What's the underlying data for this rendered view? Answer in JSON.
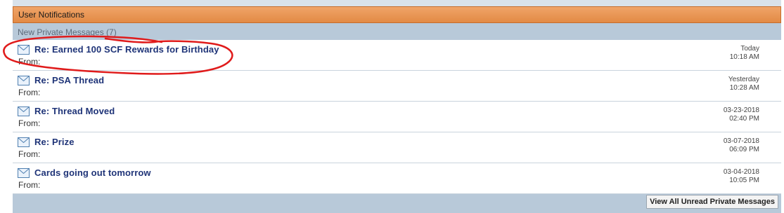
{
  "header": {
    "title": "User Notifications"
  },
  "subheader": {
    "label": "New Private Messages (7)"
  },
  "icons": {
    "message": "envelope-icon"
  },
  "messages": [
    {
      "title": "Re: Earned 100 SCF Rewards for Birthday",
      "from": "From:",
      "date": "Today",
      "time": "10:18 AM"
    },
    {
      "title": "Re: PSA Thread",
      "from": "From:",
      "date": "Yesterday",
      "time": "10:28 AM"
    },
    {
      "title": "Re: Thread Moved",
      "from": "From:",
      "date": "03-23-2018",
      "time": "02:40 PM"
    },
    {
      "title": "Re: Prize",
      "from": "From:",
      "date": "03-07-2018",
      "time": "06:09 PM"
    },
    {
      "title": "Cards going out tomorrow",
      "from": "From:",
      "date": "03-04-2018",
      "time": "10:05 PM"
    }
  ],
  "footer": {
    "view_all_label": "View All Unread Private Messages"
  },
  "colors": {
    "header": "#e8914d",
    "panel": "#b8c9d9",
    "link": "#1f3478",
    "annotation": "#e01b1b"
  }
}
